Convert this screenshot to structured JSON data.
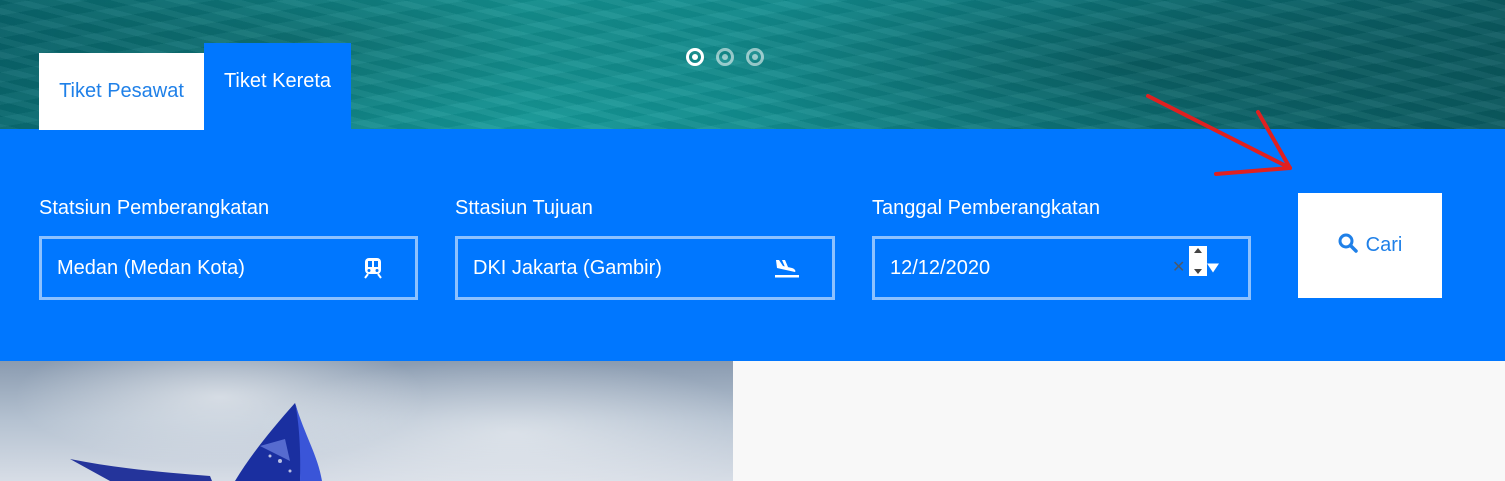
{
  "hero": {
    "carousel": {
      "count": 3,
      "active_index": 0
    }
  },
  "tabs": [
    {
      "label": "Tiket Pesawat",
      "active": false
    },
    {
      "label": "Tiket Kereta",
      "active": true
    }
  ],
  "form": {
    "departure_station": {
      "label": "Statsiun Pemberangkatan",
      "value": "Medan (Medan Kota)",
      "icon": "train-icon"
    },
    "destination_station": {
      "label": "Sttasiun Tujuan",
      "value": "DKI Jakarta (Gambir)",
      "icon": "plane-landing-icon"
    },
    "departure_date": {
      "label": "Tanggal Pemberangkatan",
      "value": "12/12/2020",
      "icon": "calendar-icon"
    },
    "search_button": {
      "label": "Cari",
      "icon": "search-icon"
    }
  },
  "colors": {
    "primary": "#0077ff",
    "tab_text": "#1f80e8",
    "annotation": "#e02020"
  }
}
